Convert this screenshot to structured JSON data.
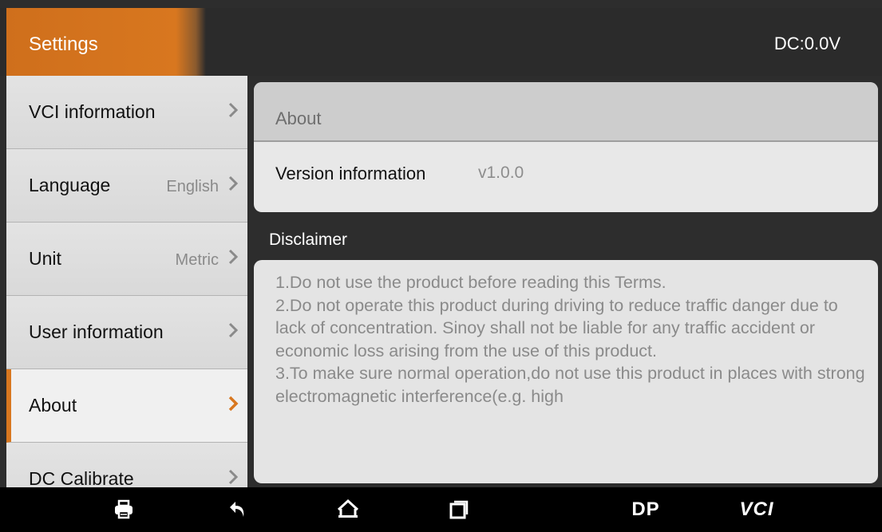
{
  "header": {
    "title": "Settings",
    "voltage": "DC:0.0V"
  },
  "sidebar": {
    "items": [
      {
        "label": "VCI information",
        "value": ""
      },
      {
        "label": "Language",
        "value": "English"
      },
      {
        "label": "Unit",
        "value": "Metric"
      },
      {
        "label": "User information",
        "value": ""
      },
      {
        "label": "About",
        "value": "",
        "active": true
      },
      {
        "label": "DC Calibrate",
        "value": ""
      }
    ]
  },
  "about": {
    "title": "About",
    "version_label": "Version information",
    "version_value": "v1.0.0"
  },
  "disclaimer": {
    "title": "Disclaimer",
    "text": "1.Do not use the product before reading this Terms.\n2.Do not operate this product during driving to reduce traffic danger due to lack of concentration. Sinoy shall not be liable for any traffic accident or economic loss arising from the use of this product.\n3.To make sure normal operation,do not use this product in places with strong electromagnetic interference(e.g. high"
  },
  "navbar": {
    "dp_label": "DP",
    "vci_label": "VCI",
    "icons": [
      "printer-icon",
      "back-icon",
      "home-icon",
      "recent-apps-icon"
    ]
  },
  "colors": {
    "accent": "#d8771f",
    "sidebar_bg": "#e2e2e2",
    "content_bg": "#2d2d2d"
  }
}
